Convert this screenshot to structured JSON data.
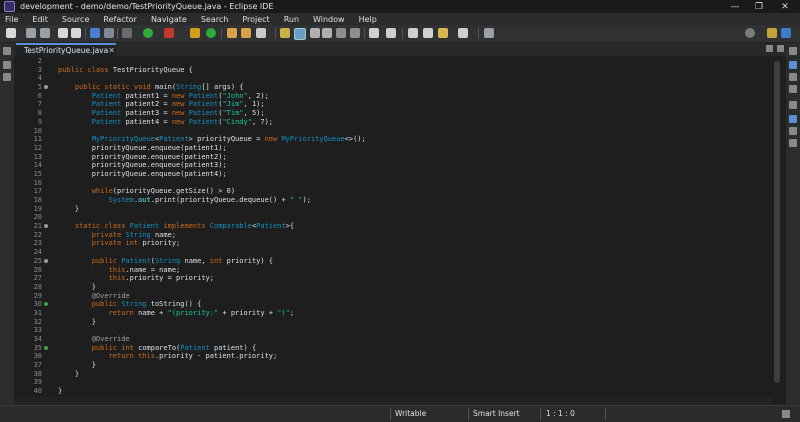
{
  "window": {
    "title": "development - demo/demo/TestPriorityQueue.java - Eclipse IDE",
    "controls": [
      "—",
      "❐",
      "✕"
    ]
  },
  "menu": [
    "File",
    "Edit",
    "Source",
    "Refactor",
    "Navigate",
    "Search",
    "Project",
    "Run",
    "Window",
    "Help"
  ],
  "editor_tab": {
    "label": "TestPriorityQueue.java",
    "close": "✕"
  },
  "code_lines": [
    {
      "n": "2",
      "mark": "",
      "src": ""
    },
    {
      "n": "3",
      "mark": "",
      "src": "public class TestPriorityQueue {"
    },
    {
      "n": "4",
      "mark": "",
      "src": ""
    },
    {
      "n": "5",
      "mark": "dot",
      "src": "    public static void main(String[] args) {"
    },
    {
      "n": "6",
      "mark": "",
      "src": "        Patient patient1 = new Patient(\"John\", 2);"
    },
    {
      "n": "7",
      "mark": "",
      "src": "        Patient patient2 = new Patient(\"Jim\", 1);"
    },
    {
      "n": "8",
      "mark": "",
      "src": "        Patient patient3 = new Patient(\"Tim\", 5);"
    },
    {
      "n": "9",
      "mark": "",
      "src": "        Patient patient4 = new Patient(\"Cindy\", 7);"
    },
    {
      "n": "10",
      "mark": "",
      "src": ""
    },
    {
      "n": "11",
      "mark": "",
      "src": "        MyPriorityQueue<Patient> priorityQueue = new MyPriorityQueue<>();"
    },
    {
      "n": "12",
      "mark": "",
      "src": "        priorityQueue.enqueue(patient1);"
    },
    {
      "n": "13",
      "mark": "",
      "src": "        priorityQueue.enqueue(patient2);"
    },
    {
      "n": "14",
      "mark": "",
      "src": "        priorityQueue.enqueue(patient3);"
    },
    {
      "n": "15",
      "mark": "",
      "src": "        priorityQueue.enqueue(patient4);"
    },
    {
      "n": "16",
      "mark": "",
      "src": ""
    },
    {
      "n": "17",
      "mark": "",
      "src": "        while(priorityQueue.getSize() > 0)"
    },
    {
      "n": "18",
      "mark": "",
      "src": "            System.out.print(priorityQueue.dequeue() + \" \");"
    },
    {
      "n": "19",
      "mark": "",
      "src": "    }"
    },
    {
      "n": "20",
      "mark": "",
      "src": ""
    },
    {
      "n": "21",
      "mark": "dot",
      "src": "    static class Patient implements Comparable<Patient>{"
    },
    {
      "n": "22",
      "mark": "",
      "src": "        private String name;"
    },
    {
      "n": "23",
      "mark": "",
      "src": "        private int priority;"
    },
    {
      "n": "24",
      "mark": "",
      "src": ""
    },
    {
      "n": "25",
      "mark": "dot",
      "src": "        public Patient(String name, int priority) {"
    },
    {
      "n": "26",
      "mark": "",
      "src": "            this.name = name;"
    },
    {
      "n": "27",
      "mark": "",
      "src": "            this.priority = priority;"
    },
    {
      "n": "28",
      "mark": "",
      "src": "        }"
    },
    {
      "n": "29",
      "mark": "",
      "src": "        @Override"
    },
    {
      "n": "30",
      "mark": "tri",
      "src": "        public String toString() {"
    },
    {
      "n": "31",
      "mark": "",
      "src": "            return name + \"(priority:\" + priority + \")\";"
    },
    {
      "n": "32",
      "mark": "",
      "src": "        }"
    },
    {
      "n": "33",
      "mark": "",
      "src": ""
    },
    {
      "n": "34",
      "mark": "",
      "src": "        @Override"
    },
    {
      "n": "35",
      "mark": "tri",
      "src": "        public int compareTo(Patient patient) {"
    },
    {
      "n": "36",
      "mark": "",
      "src": "            return this.priority - patient.priority;"
    },
    {
      "n": "37",
      "mark": "",
      "src": "        }"
    },
    {
      "n": "38",
      "mark": "",
      "src": "    }"
    },
    {
      "n": "39",
      "mark": "",
      "src": ""
    },
    {
      "n": "40",
      "mark": "",
      "src": "}"
    }
  ],
  "status": {
    "writable": "Writable",
    "insert_mode": "Smart Insert",
    "cursor": "1 : 1 : 0"
  },
  "colors": {
    "keyword": "#cc6c1d",
    "type": "#1290c3",
    "string": "#17c6a3",
    "method": "#1eb540",
    "annotation": "#a0a0a0",
    "tab_accent": "#5a8fd4"
  }
}
